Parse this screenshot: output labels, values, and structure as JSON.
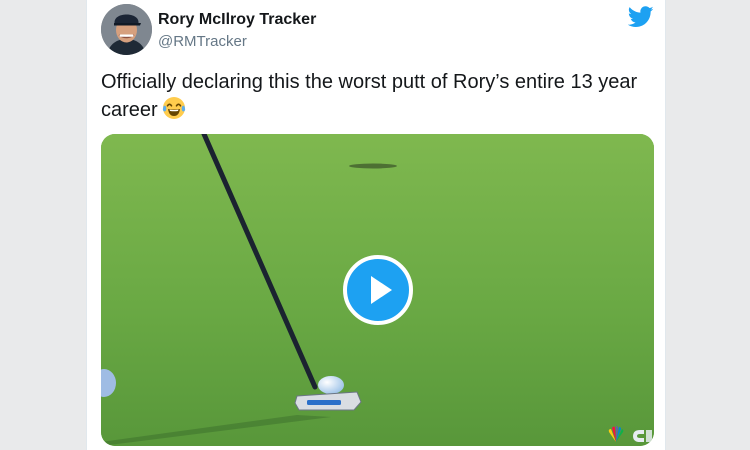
{
  "tweet": {
    "author_name": "Rory McIlroy Tracker",
    "author_handle": "@RMTracker",
    "text": "Officially declaring this the worst putt of Rory’s entire 13 year career"
  },
  "icons": {
    "bird": "twitter-bird-icon",
    "emoji": "face-with-tears-of-joy-icon",
    "play": "play-icon",
    "broadcast_logo": "nbc-peacock-logo"
  },
  "colors": {
    "brand": "#1da1f2",
    "text": "#14171a",
    "secondary": "#657786"
  }
}
